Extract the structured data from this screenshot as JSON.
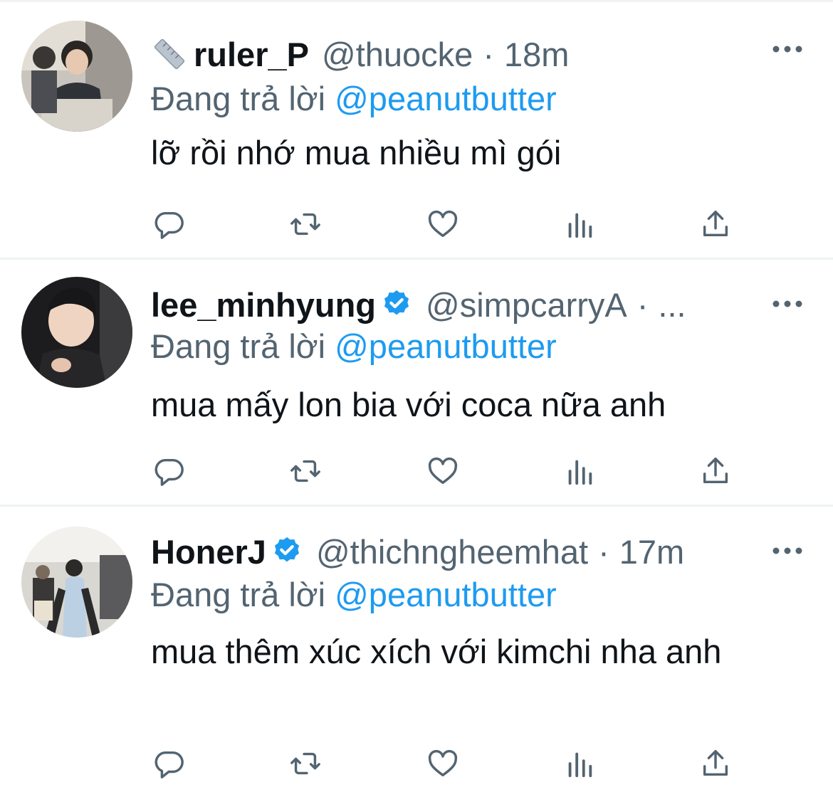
{
  "reply_prefix": "Đang trả lời",
  "tweets": [
    {
      "display_name": "ruler_P",
      "emoji_icon": "ruler-icon",
      "verified": false,
      "handle": "@thuocke",
      "separator": "·",
      "time": "18m",
      "reply_to": "@peanutbutter",
      "text": "lỡ rồi nhớ mua nhiều mì gói"
    },
    {
      "display_name": "lee_minhyung",
      "verified": true,
      "handle": "@simpcarryA",
      "separator": "·",
      "time": "...",
      "reply_to": "@peanutbutter",
      "text": "mua mấy lon bia với coca nữa anh"
    },
    {
      "display_name": "HonerJ",
      "verified": true,
      "handle": "@thichngheemhat",
      "separator": "·",
      "time": "17m",
      "reply_to": "@peanutbutter",
      "text": "mua thêm xúc xích với kimchi nha anh"
    }
  ],
  "action_icons": [
    "reply-icon",
    "retweet-icon",
    "like-icon",
    "views-icon",
    "share-icon"
  ],
  "colors": {
    "text": "#0f1419",
    "secondary": "#536471",
    "link": "#1d9bf0",
    "divider": "#eff3f4"
  }
}
